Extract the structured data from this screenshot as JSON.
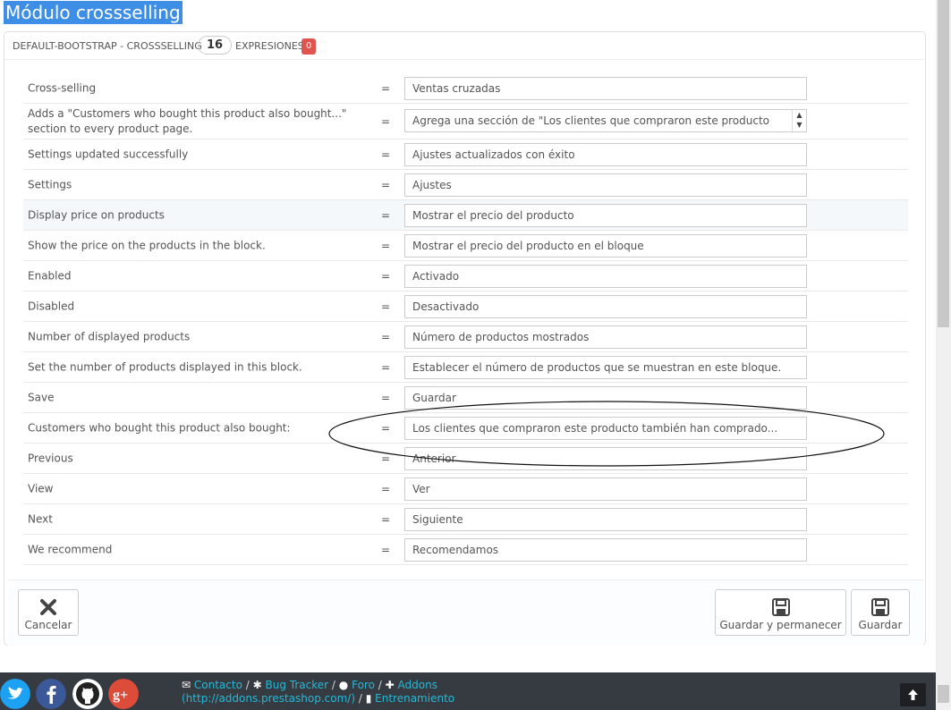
{
  "page": {
    "title": "Módulo crossselling"
  },
  "panel": {
    "header_label": "DEFAULT-BOOTSTRAP - CROSSSELLING",
    "count": "16",
    "expressions_label": "EXPRESIONES",
    "badge": "0"
  },
  "rows": [
    {
      "key": "Cross-selling",
      "eq": "=",
      "value": "Ventas cruzadas"
    },
    {
      "key": "Adds a \"Customers who bought this product also bought...\" section to every product page.",
      "eq": "=",
      "value": "Agrega una sección de \"Los clientes que compraron este producto"
    },
    {
      "key": "Settings updated successfully",
      "eq": "=",
      "value": "Ajustes actualizados con éxito"
    },
    {
      "key": "Settings",
      "eq": "=",
      "value": "Ajustes"
    },
    {
      "key": "Display price on products",
      "eq": "=",
      "value": "Mostrar el precio del producto"
    },
    {
      "key": "Show the price on the products in the block.",
      "eq": "=",
      "value": "Mostrar el precio del producto en el bloque"
    },
    {
      "key": "Enabled",
      "eq": "=",
      "value": "Activado"
    },
    {
      "key": "Disabled",
      "eq": "=",
      "value": "Desactivado"
    },
    {
      "key": "Number of displayed products",
      "eq": "=",
      "value": "Número de productos mostrados"
    },
    {
      "key": "Set the number of products displayed in this block.",
      "eq": "=",
      "value": "Establecer el número de productos que se muestran en este bloque."
    },
    {
      "key": "Save",
      "eq": "=",
      "value": "Guardar"
    },
    {
      "key": "Customers who bought this product also bought:",
      "eq": "=",
      "value": "Los clientes que compraron este producto también han comprado..."
    },
    {
      "key": "Previous",
      "eq": "=",
      "value": "Anterior"
    },
    {
      "key": "View",
      "eq": "=",
      "value": "Ver"
    },
    {
      "key": "Next",
      "eq": "=",
      "value": "Siguiente"
    },
    {
      "key": "We recommend",
      "eq": "=",
      "value": "Recomendamos"
    }
  ],
  "buttons": {
    "cancel": "Cancelar",
    "save_stay": "Guardar y permanecer",
    "save": "Guardar"
  },
  "footer": {
    "contact": "Contacto",
    "bug_tracker": "Bug Tracker",
    "forum": "Foro",
    "addons": "Addons",
    "addons_url": "(http://addons.prestashop.com/)",
    "training": "Entrenamiento",
    "sep": "/"
  },
  "icons": {
    "social": [
      "twitter-icon",
      "facebook-icon",
      "github-icon",
      "google-plus-icon"
    ]
  },
  "colors": {
    "title_bg": "#3d8ee4",
    "badge": "#e0534f",
    "footer_bg": "#363a41",
    "link": "#25b9d7"
  }
}
